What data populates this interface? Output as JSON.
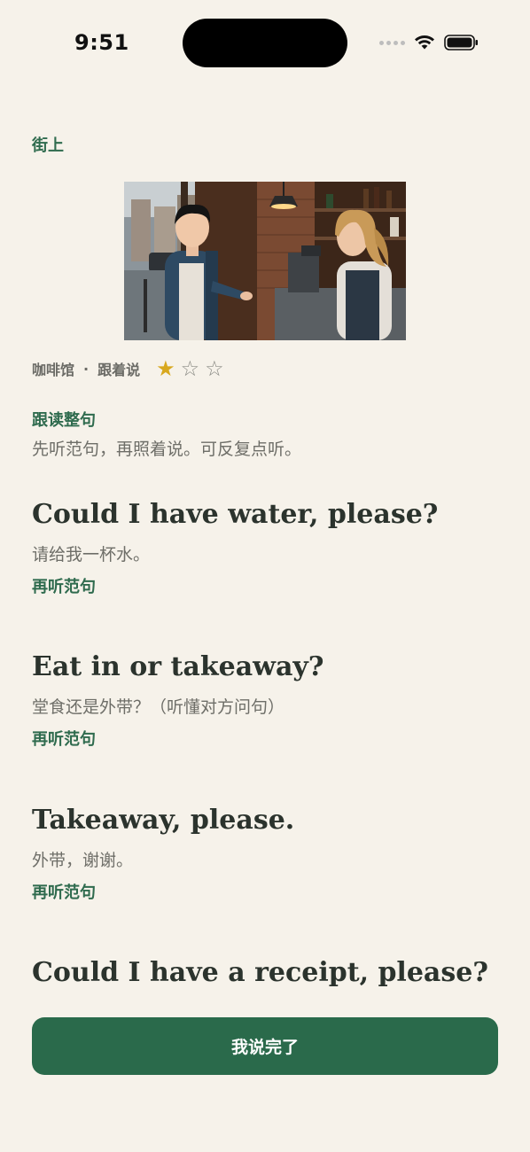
{
  "status_bar": {
    "time": "9:51"
  },
  "scene": {
    "label": "街上",
    "image_icon": "cafe-scene-illustration",
    "meta": {
      "place": "咖啡馆",
      "separator": "·",
      "mode": "跟着说",
      "stars_filled": 1,
      "stars_total": 3
    }
  },
  "section": {
    "title": "跟读整句",
    "description": "先听范句，再照着说。可反复点听。"
  },
  "sentences": [
    {
      "en": "Could I have water, please?",
      "zh": "请给我一杯水。",
      "replay_label": "再听范句"
    },
    {
      "en": "Eat in or takeaway?",
      "zh": "堂食还是外带？（听懂对方问句）",
      "replay_label": "再听范句"
    },
    {
      "en": "Takeaway, please.",
      "zh": "外带，谢谢。",
      "replay_label": "再听范句"
    },
    {
      "en": "Could I have a receipt, please?"
    }
  ],
  "footer": {
    "done_label": "我说完了"
  },
  "colors": {
    "background": "#F6F2EA",
    "accent_green": "#2F6B4E",
    "button_green": "#2A6A4B",
    "star_gold": "#D8A81E"
  }
}
